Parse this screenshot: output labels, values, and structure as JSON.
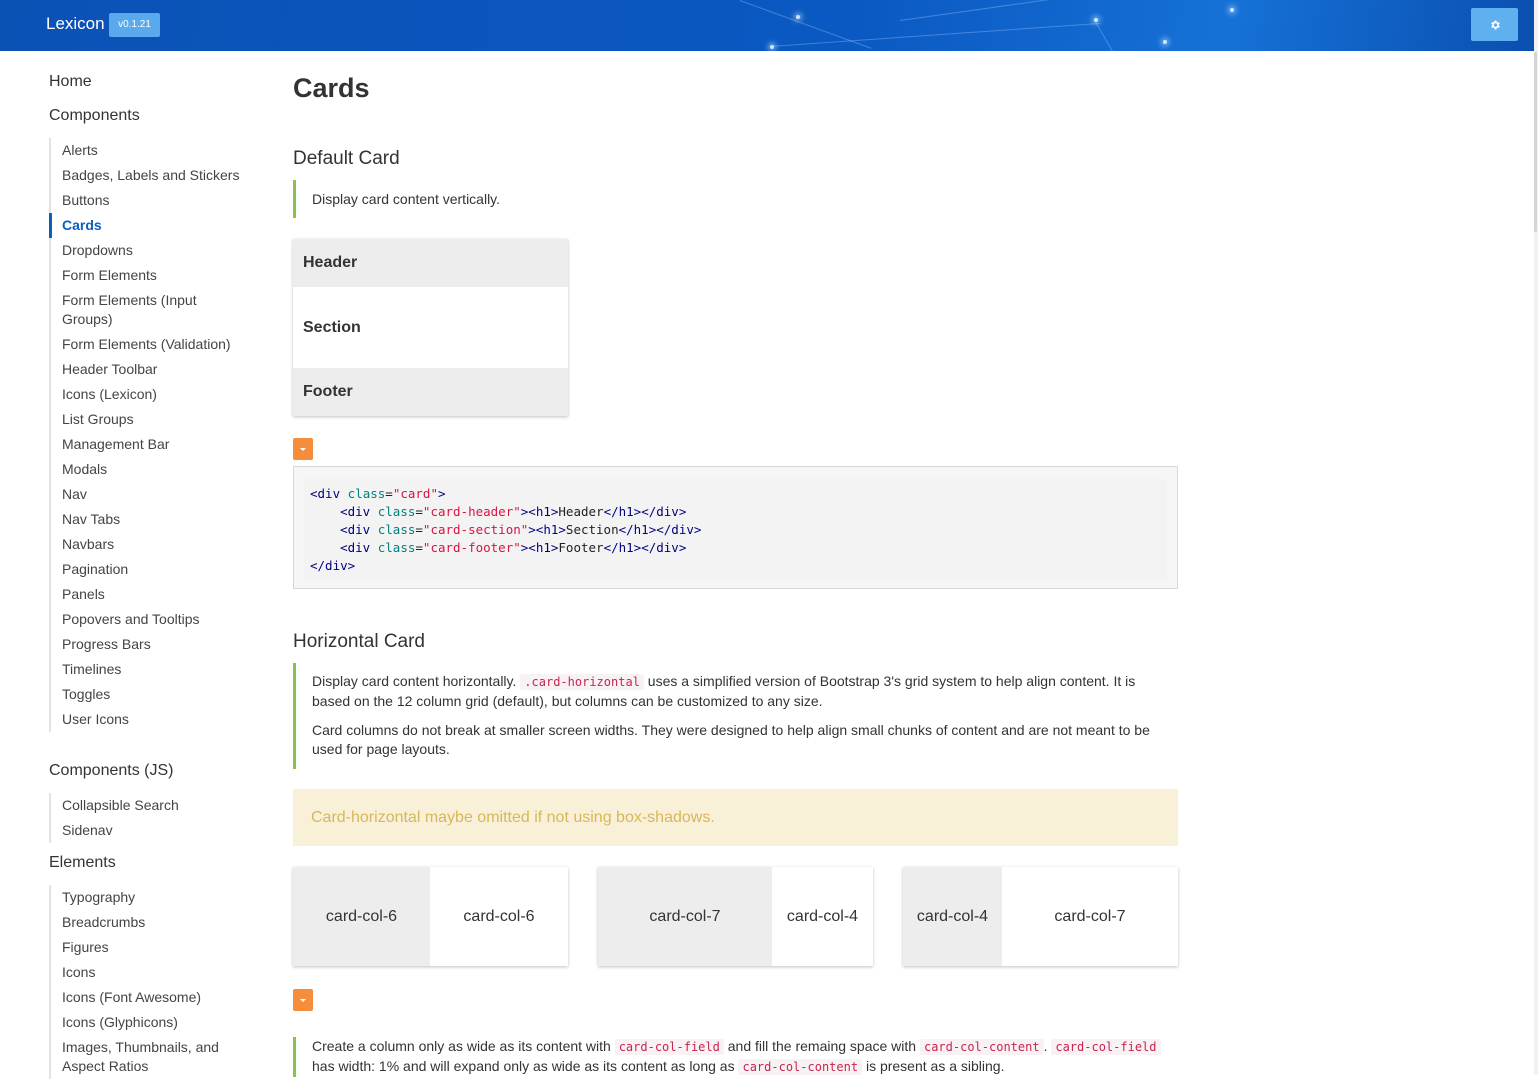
{
  "app": {
    "brand": "Lexicon",
    "version": "v0.1.21",
    "settings_icon": "gear-icon"
  },
  "sidebar": {
    "home": "Home",
    "components_title": "Components",
    "components": [
      "Alerts",
      "Badges, Labels and Stickers",
      "Buttons",
      "Cards",
      "Dropdowns",
      "Form Elements",
      "Form Elements (Input Groups)",
      "Form Elements (Validation)",
      "Header Toolbar",
      "Icons (Lexicon)",
      "List Groups",
      "Management Bar",
      "Modals",
      "Nav",
      "Nav Tabs",
      "Navbars",
      "Pagination",
      "Panels",
      "Popovers and Tooltips",
      "Progress Bars",
      "Timelines",
      "Toggles",
      "User Icons"
    ],
    "active_item": "Cards",
    "components_js_title": "Components (JS)",
    "components_js": [
      "Collapsible Search",
      "Sidenav"
    ],
    "elements_title": "Elements",
    "elements": [
      "Typography",
      "Breadcrumbs",
      "Figures",
      "Icons",
      "Icons (Font Awesome)",
      "Icons (Glyphicons)",
      "Images, Thumbnails, and Aspect Ratios"
    ]
  },
  "main": {
    "title": "Cards",
    "default_card": {
      "heading": "Default Card",
      "description": "Display card content vertically.",
      "demo": {
        "header": "Header",
        "section": "Section",
        "footer": "Footer"
      },
      "code_lines": [
        "<div class=\"card\">",
        "    <div class=\"card-header\"><h1>Header</h1></div>",
        "    <div class=\"card-section\"><h1>Section</h1></div>",
        "    <div class=\"card-footer\"><h1>Footer</h1></div>",
        "</div>"
      ]
    },
    "horizontal_card": {
      "heading": "Horizontal Card",
      "p1_before": "Display card content horizontally. ",
      "p1_code": ".card-horizontal",
      "p1_after": " uses a simplified version of Bootstrap 3's grid system to help align content. It is based on the 12 column grid (default), but columns can be customized to any size.",
      "p2": "Card columns do not break at smaller screen widths. They were designed to help align small chunks of content and are not meant to be used for page layouts.",
      "warning": "Card-horizontal maybe omitted if not using box-shadows.",
      "examples": [
        {
          "left": "card-col-6",
          "right": "card-col-6"
        },
        {
          "left": "card-col-7",
          "right": "card-col-4"
        },
        {
          "left": "card-col-4",
          "right": "card-col-7"
        }
      ],
      "p3_a": "Create a column only as wide as its content with ",
      "p3_code1": "card-col-field",
      "p3_b": " and fill the remaing space with ",
      "p3_code2": "card-col-content",
      "p3_c": ". ",
      "p3_code3": "card-col-field",
      "p3_d": " has width: 1% and will expand only as wide as its content as long as ",
      "p3_code4": "card-col-content",
      "p3_e": " is present as a sibling."
    }
  },
  "colors": {
    "topbar": "#0a58c2",
    "accent": "#0b5fbd",
    "note_border": "#8bc34a",
    "toggle": "#f68d3a",
    "warning_bg": "#f8f1d8",
    "warning_text": "#d9b65a"
  }
}
